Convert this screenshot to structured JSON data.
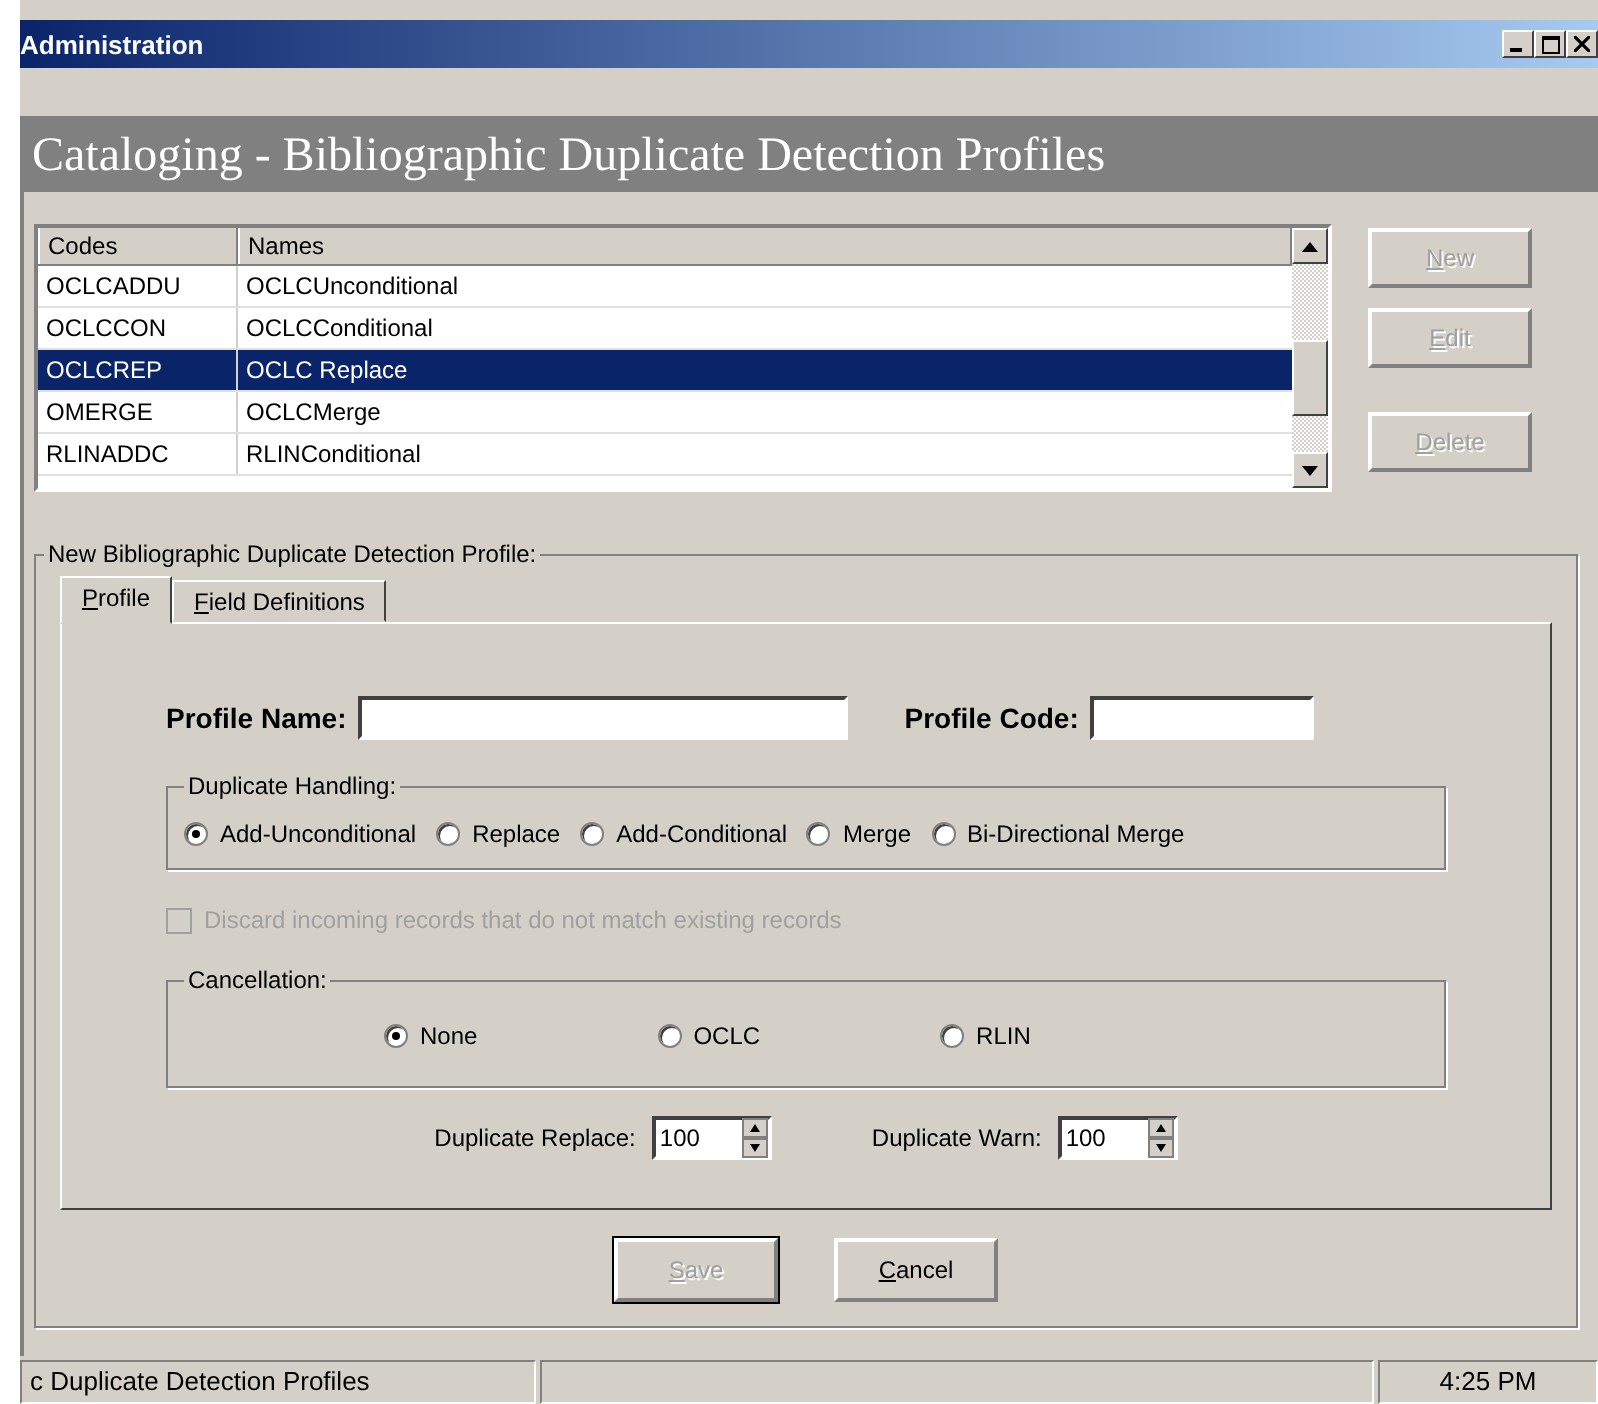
{
  "window": {
    "title": "Administration"
  },
  "header": "Cataloging - Bibliographic Duplicate Detection Profiles",
  "list": {
    "columns": [
      "Codes",
      "Names"
    ],
    "rows": [
      {
        "code": "OCLCADDU",
        "name": "OCLCUnconditional",
        "selected": false
      },
      {
        "code": "OCLCCON",
        "name": "OCLCConditional",
        "selected": false
      },
      {
        "code": "OCLCREP",
        "name": "OCLC Replace",
        "selected": true
      },
      {
        "code": "OMERGE",
        "name": "OCLCMerge",
        "selected": false
      },
      {
        "code": "RLINADDC",
        "name": "RLINConditional",
        "selected": false
      }
    ]
  },
  "side_buttons": [
    {
      "label": "New",
      "disabled": true
    },
    {
      "label": "Edit",
      "disabled": true
    },
    {
      "label": "Delete",
      "disabled": true
    }
  ],
  "group": {
    "title": "New  Bibliographic Duplicate Detection Profile:",
    "tabs": [
      {
        "label": "Profile",
        "selected": true
      },
      {
        "label": "Field Definitions",
        "selected": false
      }
    ],
    "profile_name": {
      "label": "Profile Name:"
    },
    "profile_code": {
      "label": "Profile Code:"
    },
    "duplicate_handling": {
      "title": "Duplicate Handling:",
      "options": [
        {
          "label": "Add-Unconditional",
          "selected": true
        },
        {
          "label": "Replace",
          "selected": false
        },
        {
          "label": "Add-Conditional",
          "selected": false
        },
        {
          "label": "Merge",
          "selected": false
        },
        {
          "label": "Bi-Directional Merge",
          "selected": false
        }
      ]
    },
    "discard": {
      "label": "Discard incoming records that do not match existing records",
      "checked": false,
      "disabled": true
    },
    "cancellation": {
      "title": "Cancellation:",
      "options": [
        {
          "label": "None",
          "selected": true
        },
        {
          "label": "OCLC",
          "selected": false
        },
        {
          "label": "RLIN",
          "selected": false
        }
      ]
    },
    "spinners": [
      {
        "label": "Duplicate Replace:",
        "value": "100"
      },
      {
        "label": "Duplicate Warn:",
        "value": "100"
      }
    ]
  },
  "bottom_buttons": [
    {
      "label": "Save",
      "disabled": true
    },
    {
      "label": "Cancel",
      "disabled": false
    }
  ],
  "status_bar": {
    "message": "c Duplicate Detection Profiles",
    "time": "4:25 PM"
  }
}
